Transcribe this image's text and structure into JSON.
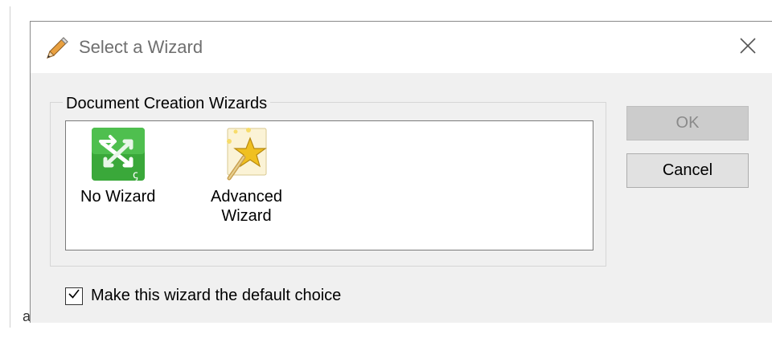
{
  "dialog": {
    "title": "Select a Wizard",
    "title_icon": "pencil-icon",
    "close_icon": "close-icon"
  },
  "group": {
    "legend": "Document Creation Wizards",
    "items": [
      {
        "label": "No Wizard",
        "icon": "no-wizard-arrows-icon",
        "icon_color": "#3aa83a"
      },
      {
        "label": "Advanced\nWizard",
        "icon": "magic-wand-star-icon",
        "icon_color": "#f0c020"
      }
    ]
  },
  "buttons": {
    "ok_label": "OK",
    "ok_enabled": false,
    "cancel_label": "Cancel"
  },
  "default_checkbox": {
    "label": "Make this wizard the default choice",
    "checked": true
  },
  "colors": {
    "dialog_bg": "#f0f0f0",
    "titlebar_bg": "#ffffff",
    "title_text": "#6f6f6f",
    "disabled_button": "#cccccc",
    "button_bg": "#e1e1e1"
  }
}
